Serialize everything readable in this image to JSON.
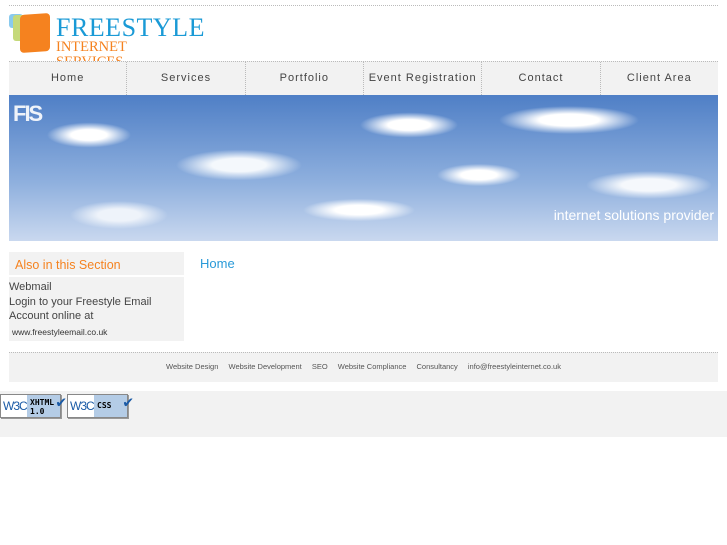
{
  "logo": {
    "line1": "FREESTYLE",
    "line2": "INTERNET SERVICES"
  },
  "nav": [
    "Home",
    "Services",
    "Portfolio",
    "Event Registration",
    "Contact",
    "Client Area"
  ],
  "banner": {
    "mark": "FIS",
    "tagline": "internet solutions provider"
  },
  "sidebar": {
    "title": "Also in this Section",
    "link": "Webmail",
    "text": "Login to your Freestyle Email Account online at",
    "url": "www.freestyleemail.co.uk"
  },
  "main": {
    "title": "Home"
  },
  "footer": [
    "Website Design",
    "Website Development",
    "SEO",
    "Website Compliance",
    "Consultancy",
    "info@freestyleinternet.co.uk"
  ],
  "badges": [
    {
      "w3c": "W3C",
      "label1": "XHTML",
      "label2": "1.0"
    },
    {
      "w3c": "W3C",
      "label1": "CSS",
      "label2": ""
    }
  ]
}
